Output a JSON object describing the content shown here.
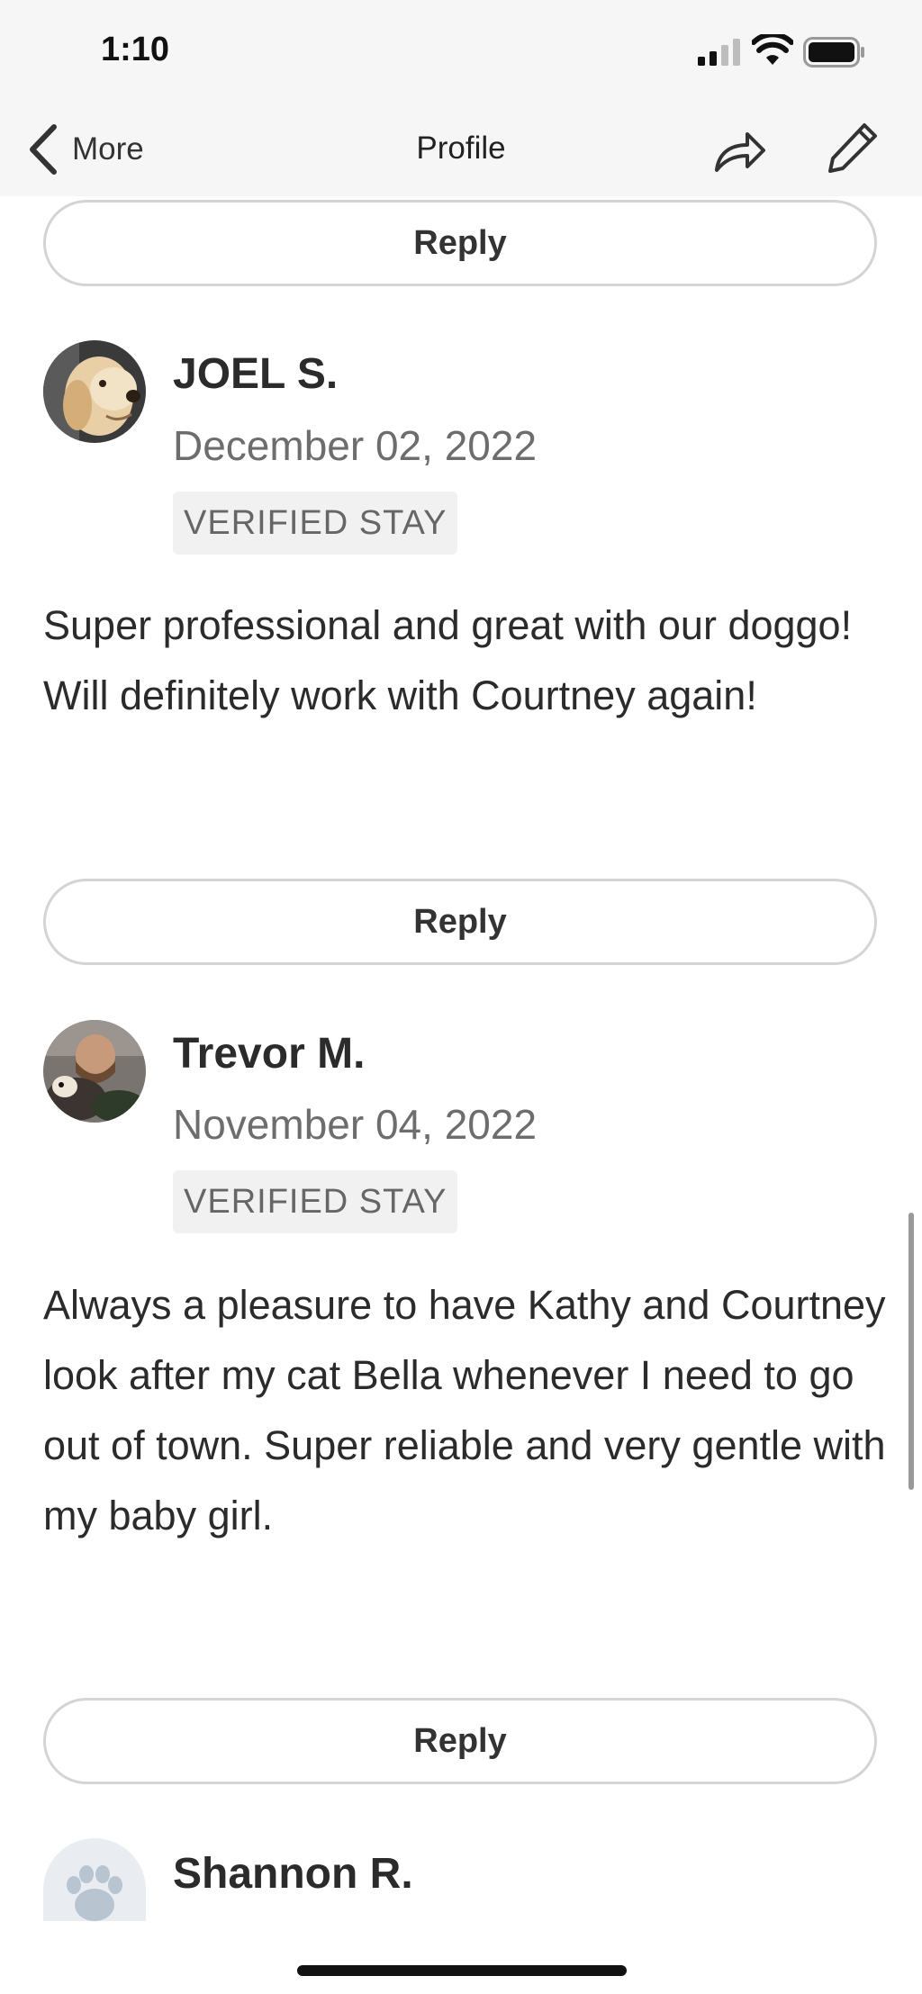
{
  "status_bar": {
    "time": "1:10"
  },
  "nav": {
    "back_label": "More",
    "title": "Profile",
    "icons": {
      "back": "chevron-left-icon",
      "share": "share-icon",
      "edit": "pencil-icon"
    }
  },
  "reviews": [
    {
      "reply_label": "Reply"
    },
    {
      "name": "JOEL S.",
      "date": "December 02, 2022",
      "badge": "VERIFIED STAY",
      "text": "Super professional and great with our doggo!  Will definitely work with Courtney again!",
      "reply_label": "Reply",
      "avatar": "dog-photo-avatar"
    },
    {
      "name": "Trevor M.",
      "date": "November 04, 2022",
      "badge": "VERIFIED STAY",
      "text": "Always a pleasure to have Kathy and Courtney look after my cat Bella whenever I need to go out of town. Super reliable and very gentle with my baby girl.",
      "reply_label": "Reply",
      "avatar": "person-with-cat-photo-avatar"
    },
    {
      "name": "Shannon R.",
      "avatar": "paw-placeholder-avatar"
    }
  ],
  "colors": {
    "bar_background": "#f6f6f6",
    "text": "#2b2b2b",
    "muted": "#6d6d6d",
    "border": "#d4d4d4"
  }
}
